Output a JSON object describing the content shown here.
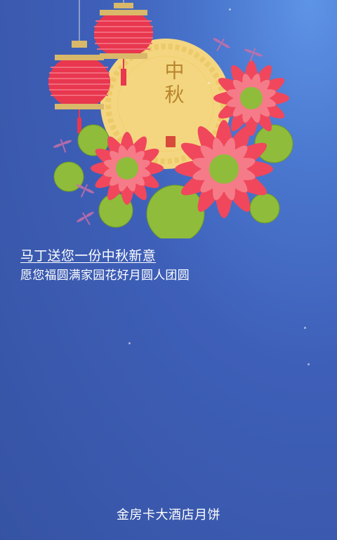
{
  "moon": {
    "text": "中秋"
  },
  "greeting": {
    "line1": "马丁送您一份中秋新意",
    "line2": "愿您福圆满家园花好月圆人团圆"
  },
  "footer": {
    "text": "金房卡大酒店月饼"
  },
  "colors": {
    "background_top": "#5e94e6",
    "background_bottom": "#3653a3",
    "moon": "#f4d680",
    "lantern": "#e8374f",
    "lotus": "#f0475c",
    "leaf": "#8fbc3a"
  }
}
